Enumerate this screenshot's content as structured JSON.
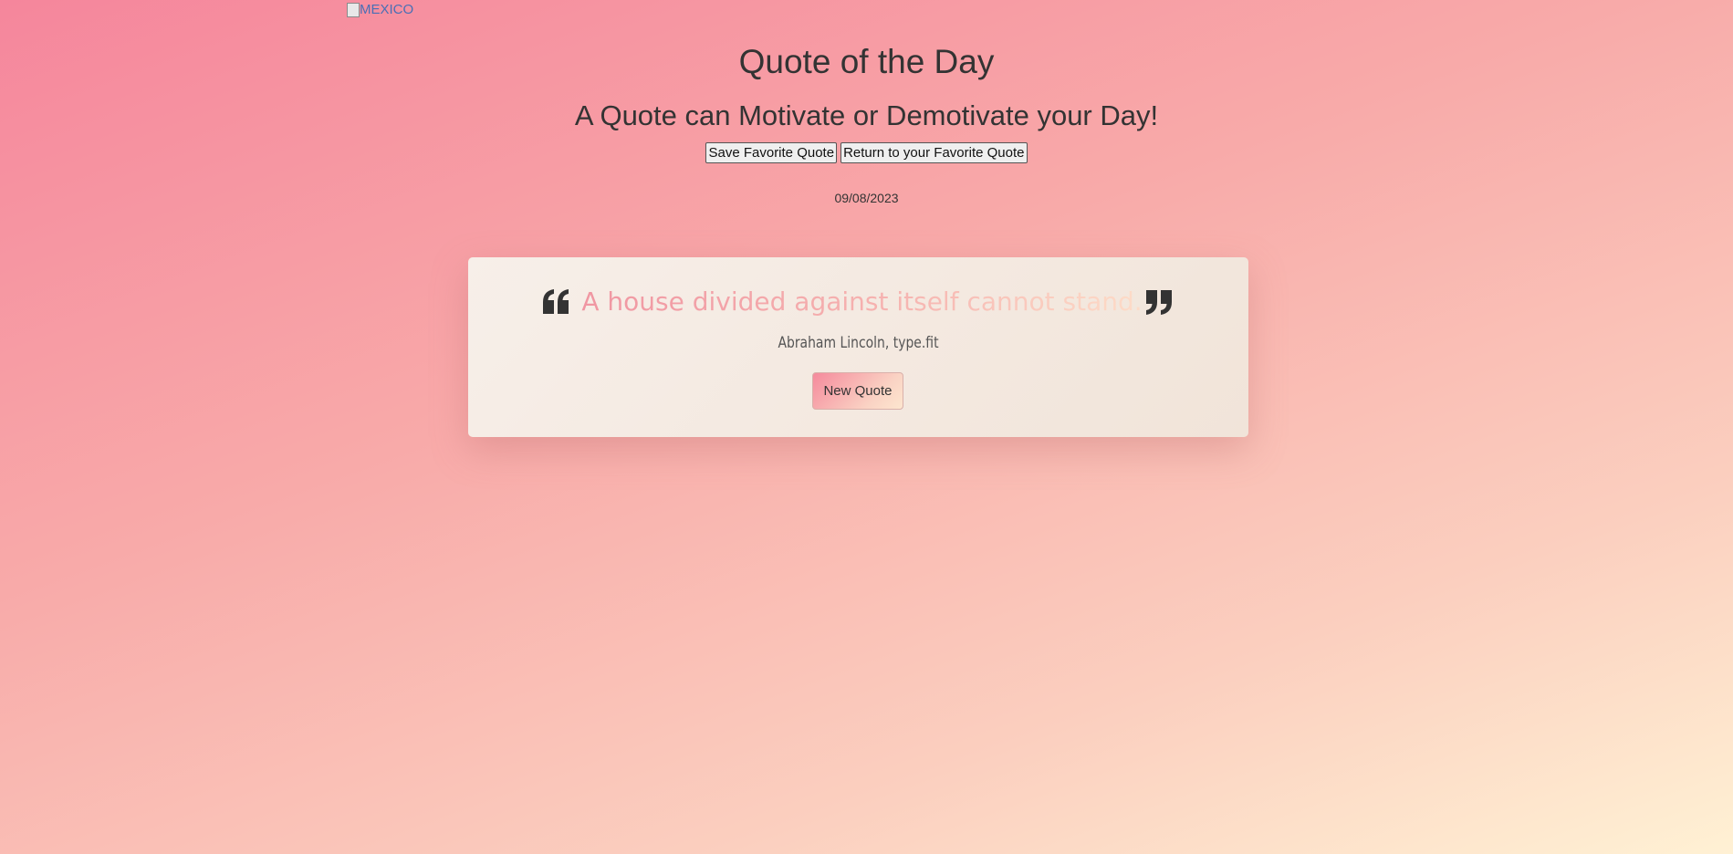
{
  "header_image": {
    "alt_text": "MEXICO"
  },
  "page": {
    "title": "Quote of the Day",
    "subtitle": "A Quote can Motivate or Demotivate your Day!",
    "date": "09/08/2023"
  },
  "actions": {
    "save_favorite_label": "Save Favorite Quote",
    "return_favorite_label": "Return to your Favorite Quote"
  },
  "quote_card": {
    "open_icon": "quote-left-icon",
    "close_icon": "quote-right-icon",
    "text": "A house divided against itself cannot stand.",
    "author": "Abraham Lincoln, type.fit",
    "new_quote_label": "New Quote"
  },
  "colors": {
    "background_start": "#f5869c",
    "background_end": "#fff1d4",
    "card_background": "#f4ebe3",
    "quote_gradient_start": "#f096a2",
    "quote_gradient_end": "#fddcc8",
    "text": "#333333"
  }
}
